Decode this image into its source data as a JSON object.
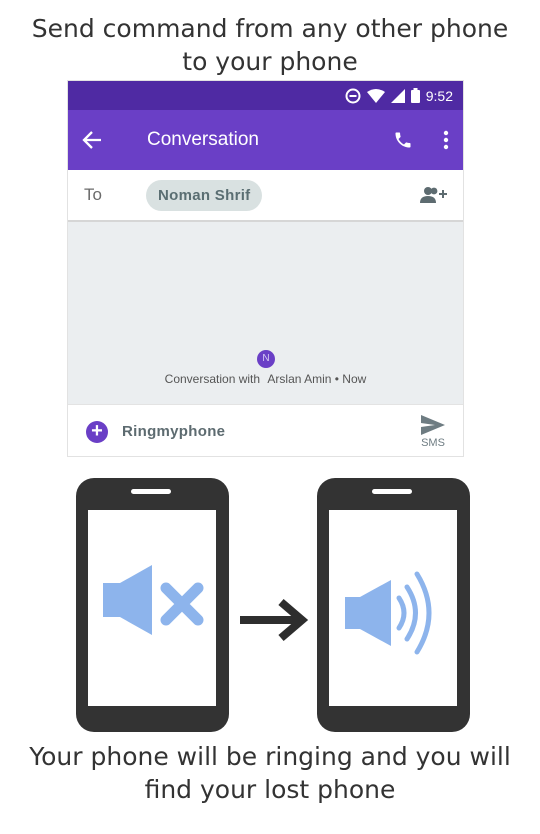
{
  "header": {
    "line1": "Send command from any other phone",
    "line2": "to your phone"
  },
  "phone_screen": {
    "status_bar": {
      "time": "9:52",
      "icons": [
        "do-not-disturb-icon",
        "wifi-icon",
        "signal-icon",
        "battery-icon"
      ]
    },
    "app_bar": {
      "title": "Conversation",
      "icons": [
        "back-arrow-icon",
        "phone-call-icon",
        "more-vert-icon"
      ]
    },
    "recipient": {
      "to_label": "To",
      "chip": "Noman Shrif"
    },
    "conversation": {
      "avatar_initial": "N",
      "prefix": "Conversation with",
      "name": "Arslan Amin • Now"
    },
    "compose": {
      "message": "Ringmyphone",
      "send_label": "SMS"
    }
  },
  "illustration": {
    "colors": {
      "phone_body": "#333333",
      "speaker": "#8db4ec",
      "arrow": "#2e2e2e"
    },
    "icons": [
      "muted-speaker-icon",
      "right-arrow-icon",
      "speaker-ringing-icon"
    ]
  },
  "footer": {
    "line1": "Your phone will be ringing and you will",
    "line2": "find your lost phone"
  },
  "theme": {
    "app_bar": "#6a3fc6",
    "status_bar": "#4f2aa3"
  }
}
